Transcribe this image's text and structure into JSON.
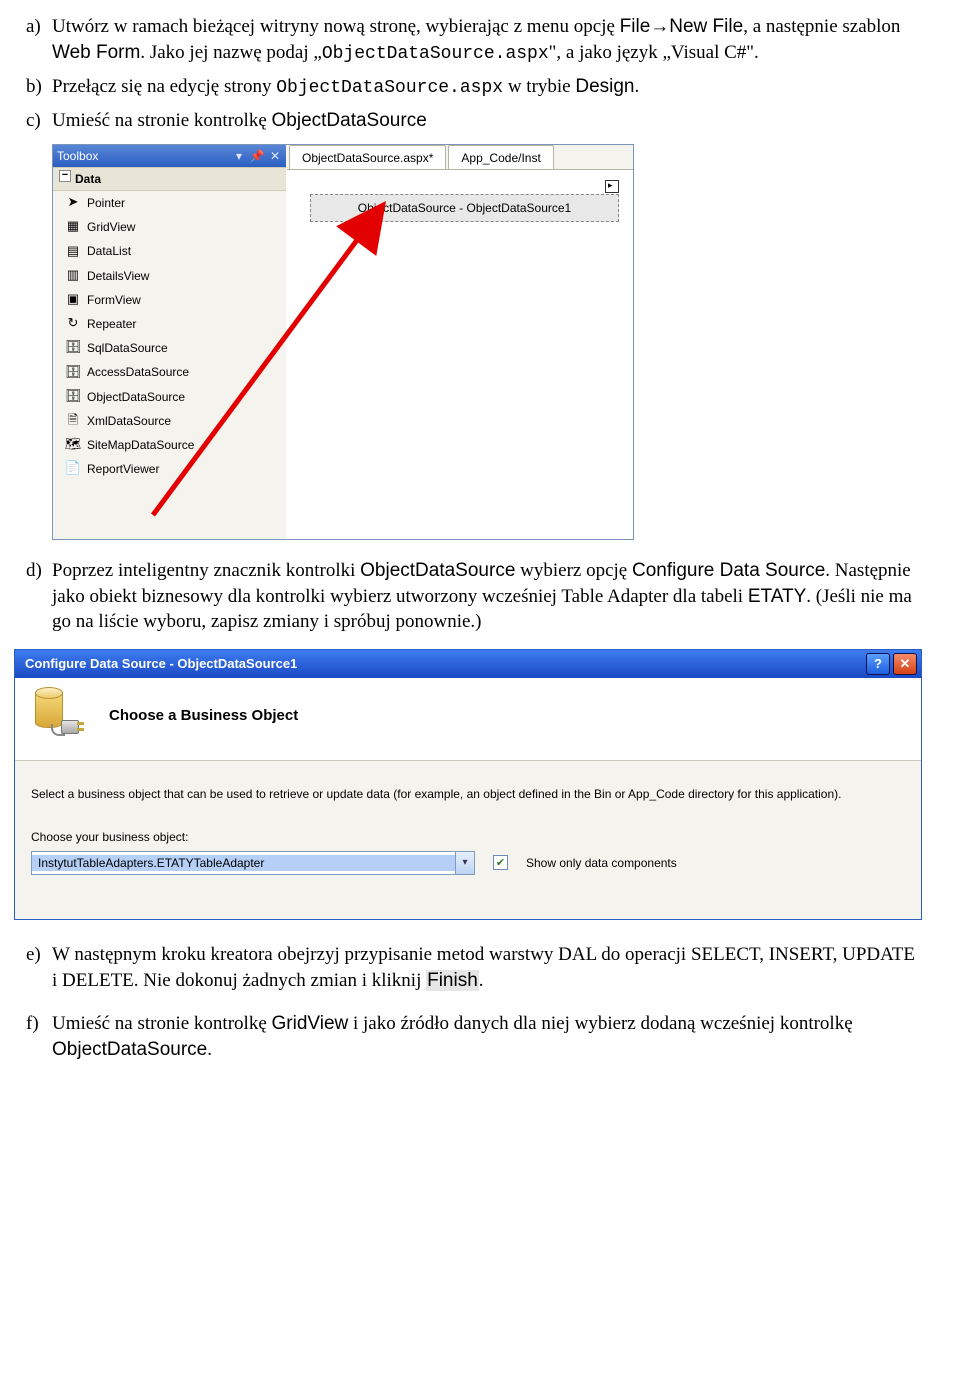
{
  "list": {
    "a": {
      "m": "a)",
      "t1": "Utwórz w ramach bieżącej witryny nową stronę, wybierając z menu opcję ",
      "t2": "File→New File",
      "t3": ", a następnie szablon ",
      "t4": "Web Form",
      "t5": ". Jako jej nazwę podaj „",
      "t6": "ObjectDataSource.aspx",
      "t7": "\", a jako język „Visual C#\"."
    },
    "b": {
      "m": "b)",
      "t1": "Przełącz się na edycję strony ",
      "t2": "ObjectDataSource.aspx",
      "t3": " w trybie ",
      "t4": "Design",
      "t5": "."
    },
    "c": {
      "m": "c)",
      "t1": "Umieść na stronie kontrolkę ",
      "t2": "ObjectDataSource"
    },
    "d": {
      "m": "d)",
      "t1": "Poprzez inteligentny znacznik kontrolki ",
      "t2": "ObjectDataSource",
      "t3": " wybierz opcję ",
      "t4": "Configure Data Source",
      "t5": ". Następnie jako obiekt biznesowy dla kontrolki wybierz utworzony wcześniej Table Adapter dla tabeli ",
      "t6": "ETATY",
      "t7": ". (Jeśli nie ma go na liście wyboru, zapisz zmiany i spróbuj ponownie.)"
    },
    "e": {
      "m": "e)",
      "t1": "W następnym kroku kreatora obejrzyj przypisanie metod warstwy DAL do operacji SELECT, INSERT, UPDATE i DELETE. Nie dokonuj żadnych zmian i kliknij ",
      "t2": "Finish",
      "t3": "."
    },
    "f": {
      "m": "f)",
      "t1": "Umieść na stronie kontrolkę ",
      "t2": "GridView",
      "t3": " i jako źródło danych dla niej wybierz dodaną wcześniej kontrolkę ",
      "t4": "ObjectDataSource",
      "t5": "."
    }
  },
  "toolbox": {
    "title": "Toolbox",
    "group": "Data",
    "items": [
      {
        "icon": "➤",
        "label": "Pointer"
      },
      {
        "icon": "▦",
        "label": "GridView"
      },
      {
        "icon": "▤",
        "label": "DataList"
      },
      {
        "icon": "▥",
        "label": "DetailsView"
      },
      {
        "icon": "▣",
        "label": "FormView"
      },
      {
        "icon": "↻",
        "label": "Repeater"
      },
      {
        "icon": "🗄",
        "label": "SqlDataSource"
      },
      {
        "icon": "🗄",
        "label": "AccessDataSource"
      },
      {
        "icon": "🗄",
        "label": "ObjectDataSource"
      },
      {
        "icon": "🗎",
        "label": "XmlDataSource"
      },
      {
        "icon": "🗺",
        "label": "SiteMapDataSource"
      },
      {
        "icon": "📄",
        "label": "ReportViewer"
      }
    ]
  },
  "designer": {
    "tab1": "ObjectDataSource.aspx*",
    "tab2": "App_Code/Inst",
    "control": "ObjectDataSource - ObjectDataSource1"
  },
  "wizard": {
    "title": "Configure Data Source - ObjectDataSource1",
    "heading": "Choose a Business Object",
    "desc": "Select a business object that can be used to retrieve or update data (for example, an object defined in the Bin or App_Code directory for this application).",
    "choose": "Choose your business object:",
    "value": "InstytutTableAdapters.ETATYTableAdapter",
    "check": "Show only data components"
  }
}
